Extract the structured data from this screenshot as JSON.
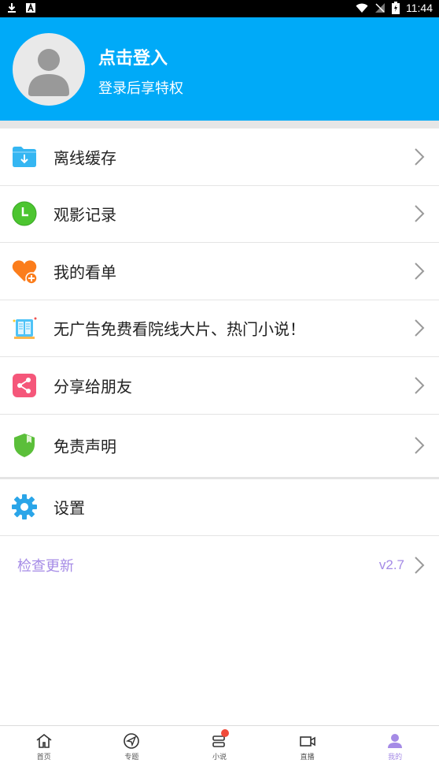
{
  "status_bar": {
    "time": "11:44"
  },
  "profile": {
    "login_title": "点击登入",
    "login_subtitle": "登录后享特权"
  },
  "menu": [
    {
      "label": "离线缓存",
      "icon": "download-folder-icon"
    },
    {
      "label": "观影记录",
      "icon": "clock-icon"
    },
    {
      "label": "我的看单",
      "icon": "heart-plus-icon"
    },
    {
      "label": "无广告免费看院线大片、热门小说！",
      "icon": "book-icon"
    },
    {
      "label": "分享给朋友",
      "icon": "share-icon"
    },
    {
      "label": "免责声明",
      "icon": "shield-icon"
    },
    {
      "label": "设置",
      "icon": "gear-icon"
    }
  ],
  "update": {
    "label": "检查更新",
    "version": "v2.7"
  },
  "bottom_nav": [
    {
      "label": "首页",
      "icon": "home-icon"
    },
    {
      "label": "专题",
      "icon": "compass-icon"
    },
    {
      "label": "小说",
      "icon": "novel-icon"
    },
    {
      "label": "直播",
      "icon": "video-icon"
    },
    {
      "label": "我的",
      "icon": "user-icon",
      "active": true
    }
  ],
  "colors": {
    "header": "#00aaf8",
    "accent": "#a58be6"
  }
}
